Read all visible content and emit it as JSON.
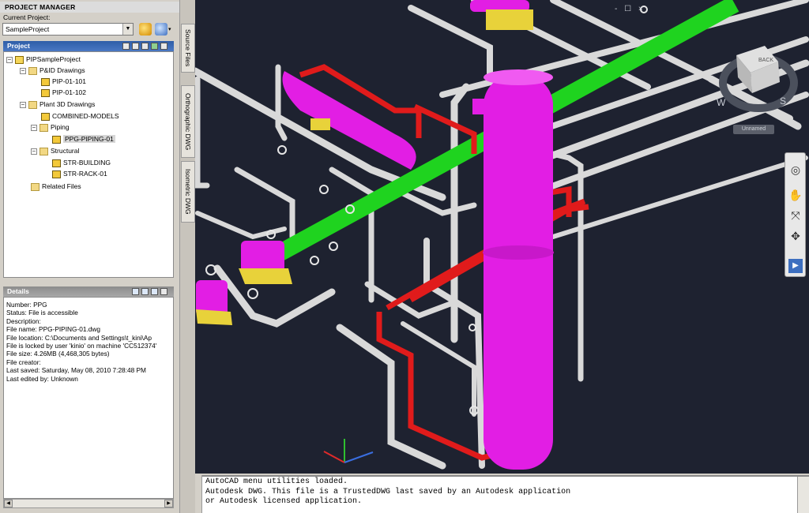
{
  "project_manager": {
    "title": "PROJECT MANAGER",
    "current_project_label": "Current Project:",
    "current_project_value": "SampleProject",
    "project_panel_title": "Project",
    "details_panel_title": "Details"
  },
  "tree": {
    "root": "PIPSampleProject",
    "pid_drawings": "P&ID Drawings",
    "pid1": "PIP-01-101",
    "pid2": "PIP-01-102",
    "plant3d": "Plant 3D Drawings",
    "combined": "COMBINED-MODELS",
    "piping": "Piping",
    "ppg": "PPG-PIPING-01",
    "structural": "Structural",
    "str_building": "STR-BUILDING",
    "str_rack": "STR-RACK-01",
    "related": "Related Files"
  },
  "details": {
    "number": "Number:  PPG",
    "status": "Status:  File is accessible",
    "description": "Description:",
    "file_name": "File name:  PPG-PIPING-01.dwg",
    "file_location": "File location:  C:\\Documents  and  Settings\\t_kini\\Ap",
    "locked": "File is locked by user 'kinio' on machine 'CC512374'",
    "file_size": "File size:  4.26MB (4,468,305 bytes)",
    "creator": "File creator:",
    "last_saved": "Last saved:  Saturday, May 08, 2010  7:28:48 PM",
    "last_edited": "Last edited by:  Unknown"
  },
  "side_tabs": {
    "source": "Source Files",
    "ortho": "Orthographic DWG",
    "iso": "Isometric DWG"
  },
  "viewport": {
    "viewcube_label": "Unnamed",
    "cube_face": "BACK",
    "compass_w": "W",
    "compass_s": "S",
    "window_controls": "- ☐ ×"
  },
  "command_line": {
    "line1": "AutoCAD menu utilities loaded.",
    "line2": "Autodesk DWG.  This file is a TrustedDWG last saved by an Autodesk application",
    "line3": "or Autodesk licensed application."
  },
  "colors": {
    "viewport_bg": "#1e2230",
    "pipe_grey": "#d9d9d9",
    "pipe_green": "#1fd31f",
    "pipe_red": "#e01b1b",
    "vessel_magenta": "#e21ee4",
    "panel_blue": "#3565b0"
  }
}
